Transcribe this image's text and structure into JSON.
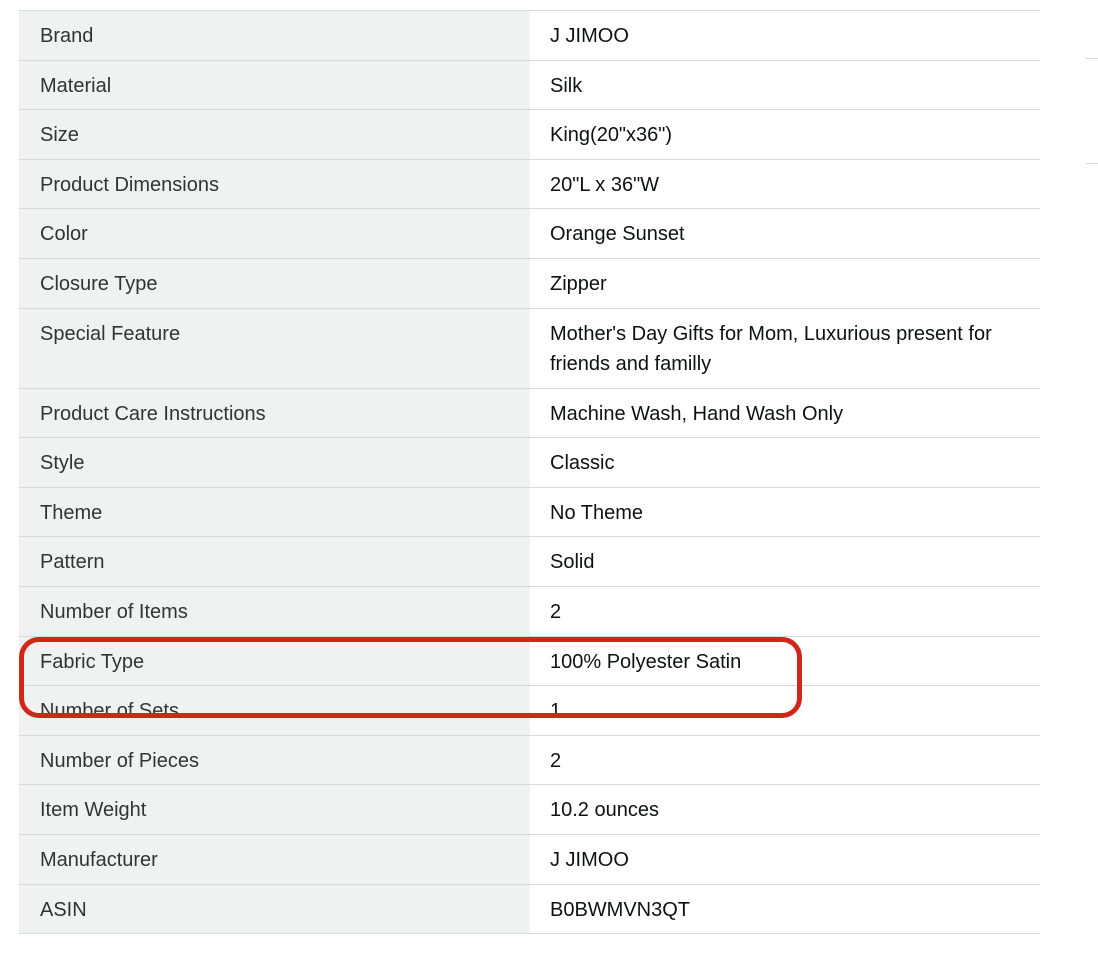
{
  "product_details": {
    "rows": [
      {
        "label": "Brand",
        "value": "J JIMOO"
      },
      {
        "label": "Material",
        "value": "Silk"
      },
      {
        "label": "Size",
        "value": "King(20\"x36\")"
      },
      {
        "label": "Product Dimensions",
        "value": "20\"L x 36\"W"
      },
      {
        "label": "Color",
        "value": "Orange Sunset"
      },
      {
        "label": "Closure Type",
        "value": "Zipper"
      },
      {
        "label": "Special Feature",
        "value": "Mother's Day Gifts for Mom, Luxurious present for friends and familly"
      },
      {
        "label": "Product Care Instructions",
        "value": "Machine Wash, Hand Wash Only"
      },
      {
        "label": "Style",
        "value": "Classic"
      },
      {
        "label": "Theme",
        "value": "No Theme"
      },
      {
        "label": "Pattern",
        "value": "Solid"
      },
      {
        "label": "Number of Items",
        "value": "2"
      },
      {
        "label": "Fabric Type",
        "value": "100% Polyester Satin"
      },
      {
        "label": "Number of Sets",
        "value": "1"
      },
      {
        "label": "Number of Pieces",
        "value": "2"
      },
      {
        "label": "Item Weight",
        "value": "10.2 ounces"
      },
      {
        "label": "Manufacturer",
        "value": "J JIMOO"
      },
      {
        "label": "ASIN",
        "value": "B0BWMVN3QT"
      }
    ]
  },
  "highlight": {
    "color": "#d1261a",
    "target_row": "Fabric Type"
  }
}
